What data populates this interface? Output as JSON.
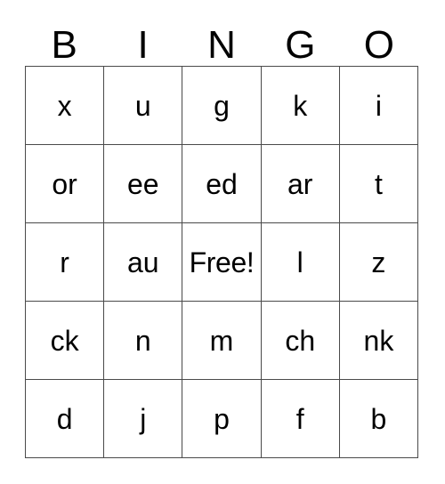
{
  "card": {
    "headers": [
      "B",
      "I",
      "N",
      "G",
      "O"
    ],
    "rows": [
      [
        "x",
        "u",
        "g",
        "k",
        "i"
      ],
      [
        "or",
        "ee",
        "ed",
        "ar",
        "t"
      ],
      [
        "r",
        "au",
        "Free!",
        "l",
        "z"
      ],
      [
        "ck",
        "n",
        "m",
        "ch",
        "nk"
      ],
      [
        "d",
        "j",
        "p",
        "f",
        "b"
      ]
    ],
    "free_space": {
      "label": "Free!",
      "row": 2,
      "col": 2
    },
    "colors": {
      "border": "#4a4a4a",
      "text": "#000000",
      "background": "#ffffff"
    }
  }
}
